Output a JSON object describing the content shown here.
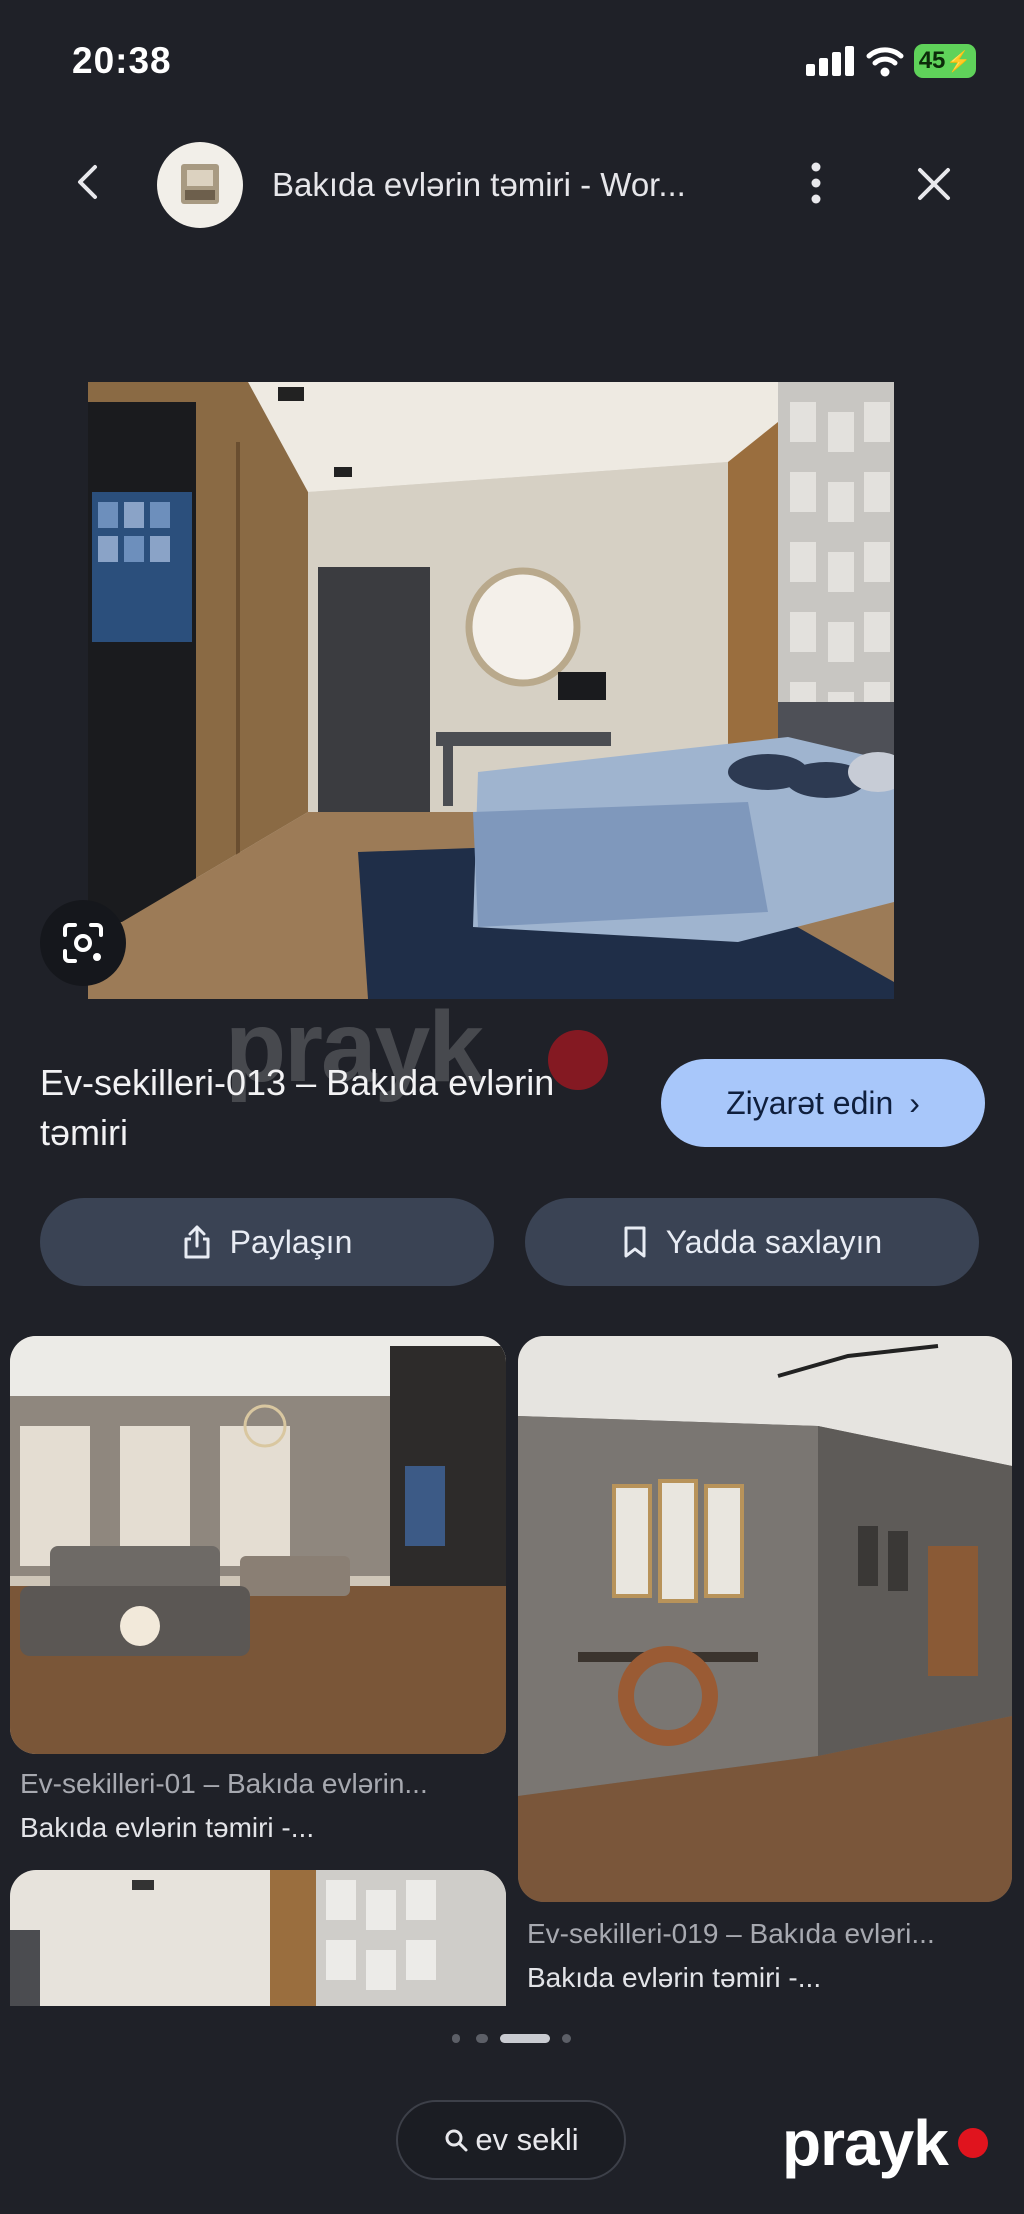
{
  "status": {
    "time": "20:38",
    "battery": "45"
  },
  "header": {
    "title": "Bakıda evlərin təmiri - Wor..."
  },
  "result": {
    "title": "Ev-sekilleri-013 – Bakıda evlərin təmiri",
    "visit_label": "Ziyarət edin",
    "share_label": "Paylaşın",
    "save_label": "Yadda saxlayın"
  },
  "watermark": "prayk",
  "related": [
    {
      "caption_title": "Ev-sekilleri-01 – Bakıda evlərin...",
      "caption_source": "Bakıda evlərin təmiri -..."
    },
    {
      "caption_title": "Ev-sekilleri-019 – Bakıda evləri...",
      "caption_source": "Bakıda evlərin təmiri -..."
    }
  ],
  "search_chip": {
    "label": "ev sekli"
  },
  "logo": "prayk",
  "colors": {
    "background": "#1f2128",
    "visit_button": "#a8c7fa",
    "action_button": "#3a4354",
    "battery": "#5fd25a",
    "logo_dot": "#e0141e"
  },
  "icons": [
    "back-arrow-icon",
    "more-vert-icon",
    "close-icon",
    "lens-icon",
    "share-icon",
    "bookmark-icon",
    "chevron-right-icon",
    "search-icon"
  ]
}
